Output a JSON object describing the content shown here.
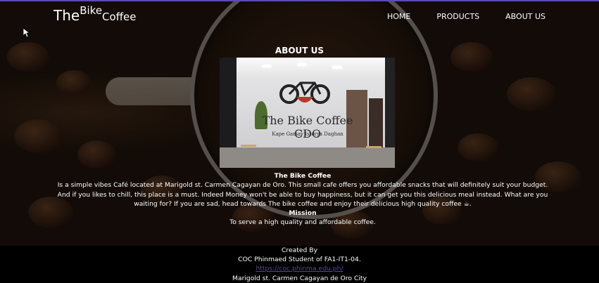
{
  "brand": {
    "the": "The",
    "bike": "Bike",
    "coffee": "Coffee"
  },
  "nav": {
    "home": "HOME",
    "products": "PRODUCTS",
    "about": "ABOUT US"
  },
  "about": {
    "title": "ABOUT US",
    "photo_sign": "The Bike Coffee CDO",
    "photo_tagline": "Kape Gamay Istorya Daghan",
    "heading": "The Bike Coffee",
    "description": "Is a simple vibes Café located at Marigold st. Carmen Cagayan de Oro. This small cafe offers you affordable snacks that will definitely suit your budget. And if you likes to chill, this place is a must. Indeed Money won't be able to buy happiness, but it can get you this delicious meal instead. What are you waiting for? If you are sad, head towards The bike coffee and enjoy their delicious high quality coffee ☕.",
    "mission_heading": "Mission",
    "mission_text": "To serve a high quality and affordable coffee."
  },
  "footer": {
    "created_by": "Created By",
    "author": "COC Phinmaed Student of FA1-IT1-04.",
    "link": "https://coc.phinma.edu.ph/",
    "address": "Marigold st. Carmen Cagayan de Oro City"
  },
  "colors": {
    "accent_topline": "#5a4bb8",
    "link": "#5c44a6",
    "footer_bg": "#000000"
  }
}
